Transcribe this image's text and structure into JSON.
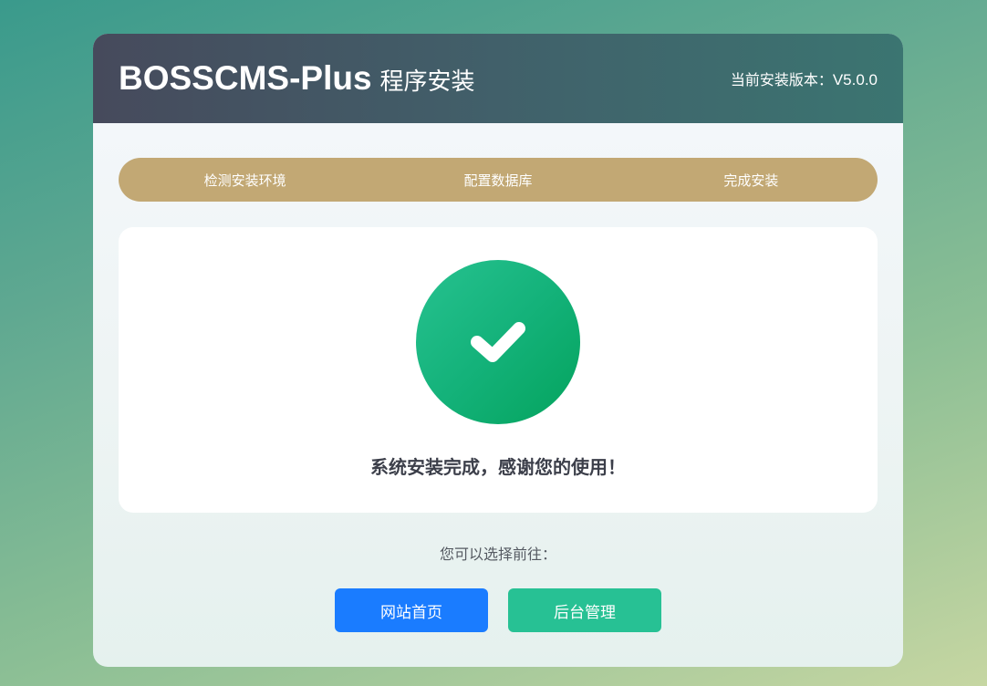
{
  "header": {
    "brand_name": "BOSSCMS-Plus",
    "brand_sub": "程序安装",
    "version_label": "当前安装版本：",
    "version_value": "V5.0.0"
  },
  "steps": [
    {
      "label": "检测安装环境"
    },
    {
      "label": "配置数据库"
    },
    {
      "label": "完成安装"
    }
  ],
  "result": {
    "icon": "check-icon",
    "message": "系统安装完成，感谢您的使用！"
  },
  "navigation": {
    "prompt": "您可以选择前往：",
    "home_button": "网站首页",
    "admin_button": "后台管理"
  },
  "colors": {
    "steps_bar": "#c2a874",
    "success": "#14b27a",
    "home_button": "#1a7cff",
    "admin_button": "#27c194"
  }
}
